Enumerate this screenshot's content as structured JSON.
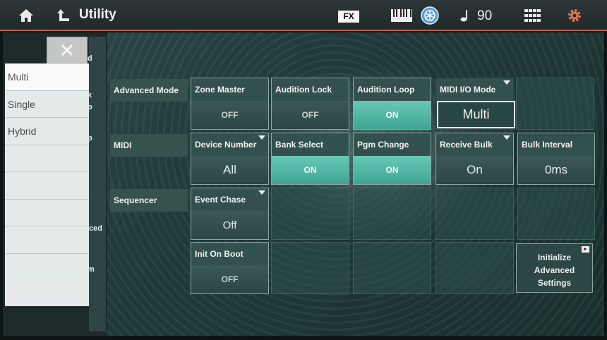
{
  "header": {
    "title": "Utility",
    "fx_label": "FX",
    "tempo_value": "90"
  },
  "popup": {
    "options": [
      "Multi",
      "Single",
      "Hybrid",
      "",
      "",
      "",
      "",
      ""
    ],
    "selected_index": 0
  },
  "side_nav_fragments": [
    "d",
    "k",
    "p",
    "p",
    "ced",
    "m"
  ],
  "rows": {
    "advanced_mode": "Advanced Mode",
    "midi": "MIDI",
    "sequencer": "Sequencer"
  },
  "params": {
    "zone_master": {
      "label": "Zone Master",
      "value": "OFF"
    },
    "audition_lock": {
      "label": "Audition Lock",
      "value": "OFF"
    },
    "audition_loop": {
      "label": "Audition Loop",
      "value": "ON"
    },
    "midi_io_mode": {
      "label": "MIDI I/O Mode",
      "value": "Multi"
    },
    "device_number": {
      "label": "Device Number",
      "value": "All"
    },
    "bank_select": {
      "label": "Bank Select",
      "value": "ON"
    },
    "pgm_change": {
      "label": "Pgm Change",
      "value": "ON"
    },
    "receive_bulk": {
      "label": "Receive Bulk",
      "value": "On"
    },
    "bulk_interval": {
      "label": "Bulk Interval",
      "value": "0ms"
    },
    "event_chase": {
      "label": "Event Chase",
      "value": "Off"
    },
    "init_on_boot": {
      "label": "Init On Boot",
      "value": "OFF"
    }
  },
  "initialize_button": {
    "line1": "Initialize",
    "line2": "Advanced",
    "line3": "Settings"
  },
  "colors": {
    "accent": "#c85a3e",
    "on": "#4fb6a2",
    "panel": "#2c4746"
  }
}
